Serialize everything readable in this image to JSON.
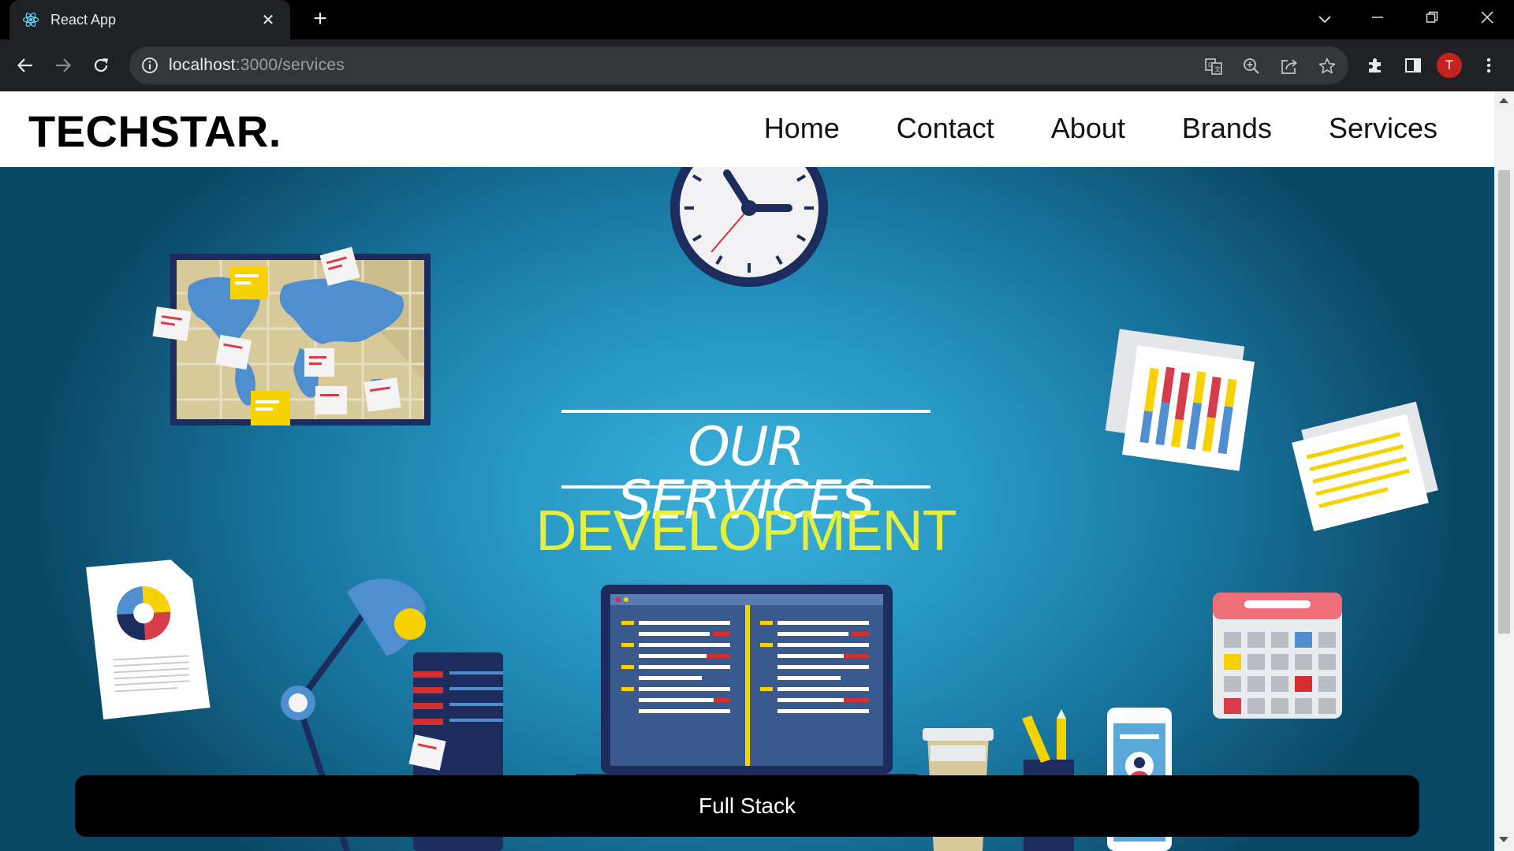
{
  "browser": {
    "tab_title": "React App",
    "close_glyph": "✕",
    "new_tab_glyph": "+",
    "url_host": "localhost",
    "url_path": ":3000/services",
    "profile_initial": "T",
    "icons": [
      "react-favicon",
      "back-arrow-icon",
      "forward-arrow-icon",
      "reload-icon",
      "site-info-icon",
      "translate-icon",
      "zoom-icon",
      "share-icon",
      "bookmark-star-icon",
      "extensions-puzzle-icon",
      "side-panel-icon",
      "kebab-menu-icon"
    ],
    "window_controls": {
      "tab_search": "⌄",
      "minimize": "—",
      "restore": "❐",
      "close": "✕"
    }
  },
  "site": {
    "brand": "TECHSTAR.",
    "nav": [
      "Home",
      "Contact",
      "About",
      "Brands",
      "Services"
    ]
  },
  "hero": {
    "subtitle": "OUR SERVICES",
    "title": "DEVELOPMENT",
    "title_color": "#e6ef3b"
  },
  "service": {
    "label": "Full Stack"
  },
  "colors": {
    "accent_avatar": "#c5221f",
    "hero_bg": "#2391bf"
  }
}
